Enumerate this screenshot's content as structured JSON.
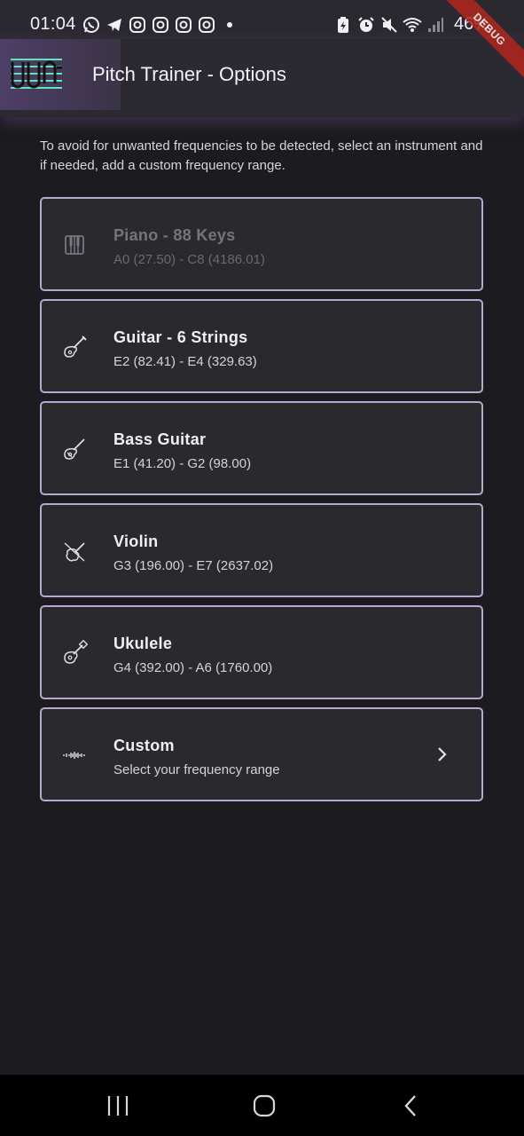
{
  "status_bar": {
    "time": "01:04",
    "battery": "46%",
    "left_icons": [
      "whatsapp-icon",
      "telegram-icon",
      "instagram-icon",
      "instagram-icon",
      "instagram-icon",
      "instagram-icon",
      "dot-icon"
    ],
    "right_icons": [
      "battery-saver-icon",
      "alarm-icon",
      "mute-icon",
      "wifi-icon",
      "signal-icon"
    ]
  },
  "debug_ribbon": "DEBUG",
  "app_bar": {
    "title": "Pitch Trainer - Options",
    "logo_icon": "waveform-logo-icon"
  },
  "intro": "To avoid for unwanted frequencies to be detected, select an instrument and if needed, add a custom frequency range.",
  "instruments": [
    {
      "title": "Piano - 88 Keys",
      "range": "A0 (27.50) - C8 (4186.01)",
      "icon": "piano-icon",
      "enabled": false
    },
    {
      "title": "Guitar - 6 Strings",
      "range": "E2 (82.41) - E4 (329.63)",
      "icon": "guitar-icon",
      "enabled": true
    },
    {
      "title": "Bass Guitar",
      "range": "E1 (41.20) - G2 (98.00)",
      "icon": "bass-guitar-icon",
      "enabled": true
    },
    {
      "title": "Violin",
      "range": "G3 (196.00) - E7 (2637.02)",
      "icon": "violin-icon",
      "enabled": true
    },
    {
      "title": "Ukulele",
      "range": "G4 (392.00) - A6 (1760.00)",
      "icon": "ukulele-icon",
      "enabled": true
    },
    {
      "title": "Custom",
      "range": "Select your frequency range",
      "icon": "frequency-range-icon",
      "enabled": true,
      "chevron": "chevron-right-icon"
    }
  ],
  "colors": {
    "background": "#1c1b1f",
    "card_border": "#b7a7d1",
    "card_background": "#2a292d",
    "app_bar": "#2c2a31",
    "logo_accent": "#5fe3c1",
    "debug": "#b3261e"
  },
  "nav_bar": [
    "recent-apps-icon",
    "home-icon",
    "back-icon"
  ]
}
